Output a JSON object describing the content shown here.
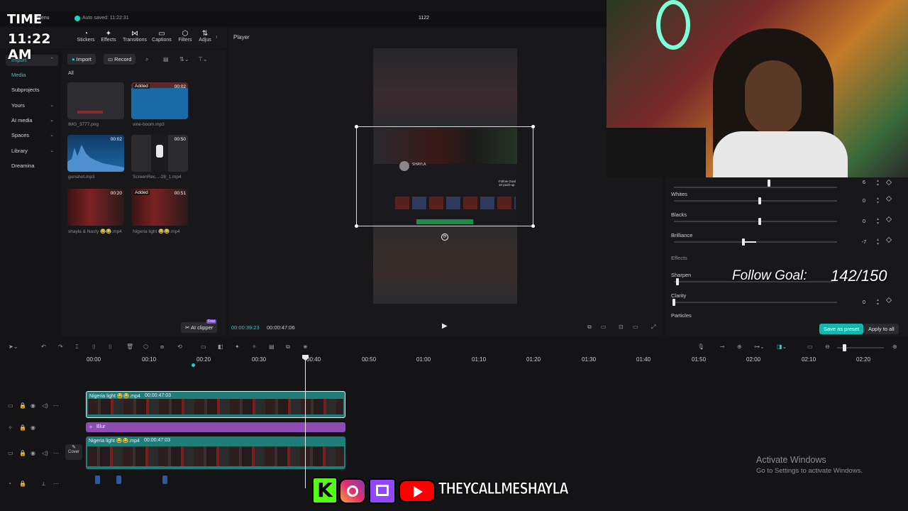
{
  "overlay": {
    "time_label": "TIME",
    "clock": "11:22 AM",
    "follow_goal_label": "Follow Goal:",
    "follow_goal_value": "142/150",
    "social_handle": "THEYCALLMESHAYLA"
  },
  "app": {
    "menu_label": "Menu",
    "autosave": "Auto saved: 11:22:31",
    "project_name": "1122",
    "tools": [
      "Stickers",
      "Effects",
      "Transitions",
      "Captions",
      "Filters",
      "Adjus"
    ],
    "tool_icons": [
      "sticker-icon",
      "effects-icon",
      "transitions-icon",
      "captions-icon",
      "filters-icon",
      "adjust-icon"
    ]
  },
  "left_nav": {
    "items": [
      {
        "label": "Import",
        "selected": true
      },
      {
        "label": "Media",
        "selected": false,
        "accent": true
      },
      {
        "label": "Subprojects"
      },
      {
        "label": "Yours"
      },
      {
        "label": "AI media"
      },
      {
        "label": "Spaces"
      },
      {
        "label": "Library"
      },
      {
        "label": "Dreamina"
      }
    ]
  },
  "media": {
    "import_btn": "Import",
    "record_btn": "Record",
    "filter_label": "All",
    "ai_clipper": "AI clipper",
    "ai_badge": "Free",
    "items": [
      {
        "name": "IMG_3777.png",
        "duration": "",
        "added": false
      },
      {
        "name": "vine-boom.mp3",
        "duration": "00:02",
        "added": true
      },
      {
        "name": "gunshot.mp3",
        "duration": "00:02",
        "added": false
      },
      {
        "name": "ScreenRec...-28_1.mp4",
        "duration": "00:50",
        "added": false
      },
      {
        "name": "shayla & Nasty 😂😂.mp4",
        "duration": "00:20",
        "added": false
      },
      {
        "name": "Nigeria light 😂😂.mp4",
        "duration": "00:51",
        "added": true
      }
    ],
    "added_label": "Added"
  },
  "player": {
    "title": "Player",
    "current_time": "00:00:39:23",
    "total_time": "00:00:47:06",
    "preview_caption": "Follow Goal 10 push-up",
    "preview_channel": "SHAYLA"
  },
  "adjust": {
    "rows": [
      {
        "label": "",
        "value": "6"
      },
      {
        "label": "Whites",
        "value": "0"
      },
      {
        "label": "Blacks",
        "value": "0"
      },
      {
        "label": "Brilliance",
        "value": "-7"
      }
    ],
    "effects_label": "Effects",
    "sharpen_label": "Sharpen",
    "clarity_label": "Clarity",
    "clarity_value": "0",
    "particles_label": "Particles",
    "save_preset": "Save as preset",
    "apply_all": "Apply to all"
  },
  "timeline": {
    "ruler": [
      "00:00",
      "00:10",
      "00:20",
      "00:30",
      "00:40",
      "00:50",
      "01:00",
      "01:10",
      "01:20",
      "01:30",
      "01:40",
      "01:50",
      "02:00",
      "02:10",
      "02:20"
    ],
    "tracks": [
      {
        "name": "Nigeria light 😂😂.mp4",
        "duration": "00:00:47:03"
      },
      {
        "name": "Blur"
      },
      {
        "name": "Nigeria light 😂😂.mp4",
        "duration": "00:00:47:03"
      }
    ],
    "cover_label": "Cover"
  },
  "watermark": {
    "title": "Activate Windows",
    "subtitle": "Go to Settings to activate Windows."
  },
  "colors": {
    "accent": "#1ad3c9",
    "clip_teal": "#1f7f78",
    "blur_purple": "#8e4bb3",
    "save_btn": "#11b8b0"
  }
}
